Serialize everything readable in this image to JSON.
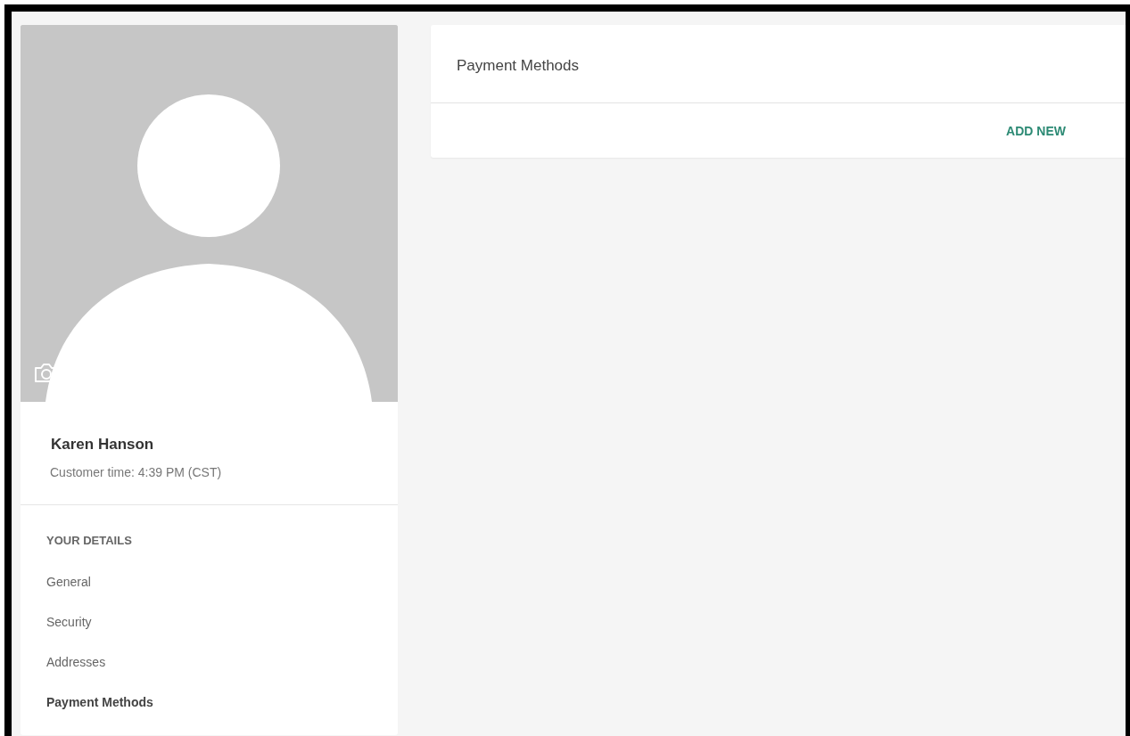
{
  "profile": {
    "name": "Karen Hanson",
    "customer_time": "Customer time: 4:39 PM (CST)"
  },
  "sidebar": {
    "heading": "YOUR DETAILS",
    "items": [
      {
        "label": "General",
        "selected": false
      },
      {
        "label": "Security",
        "selected": false
      },
      {
        "label": "Addresses",
        "selected": false
      },
      {
        "label": "Payment Methods",
        "selected": true
      }
    ]
  },
  "panel": {
    "title": "Payment Methods",
    "action": "ADD NEW"
  }
}
